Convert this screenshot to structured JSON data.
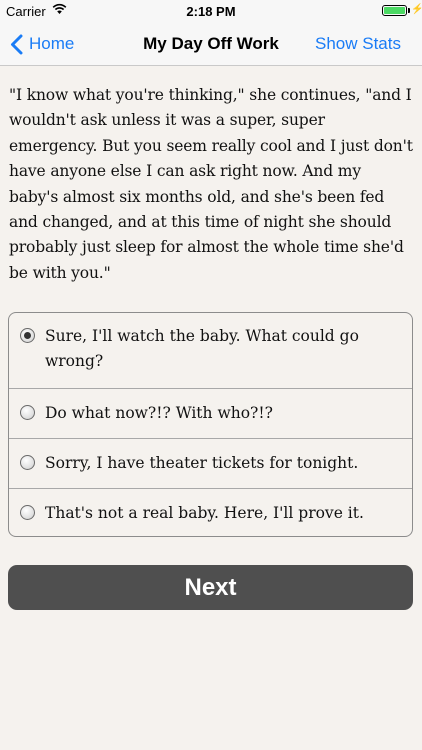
{
  "status_bar": {
    "carrier": "Carrier",
    "time": "2:18 PM",
    "wifi_icon": "wifi-icon",
    "battery_icon": "battery-icon",
    "battery_level": 1.0
  },
  "nav": {
    "back_label": "Home",
    "title": "My Day Off Work",
    "right_label": "Show Stats"
  },
  "story": {
    "text": "\"I know what you're thinking,\" she continues, \"and I wouldn't ask unless it was a super, super emergency. But you seem really cool and I just don't have anyone else I can ask right now. And my baby's almost six months old, and she's been fed and changed, and at this time of night she should probably just sleep for almost the whole time she'd be with you.\""
  },
  "choices": [
    {
      "label": "Sure, I'll watch the baby. What could go wrong?",
      "selected": true
    },
    {
      "label": "Do what now?!? With who?!?",
      "selected": false
    },
    {
      "label": "Sorry, I have theater tickets for tonight.",
      "selected": false
    },
    {
      "label": "That's not a real baby. Here, I'll prove it.",
      "selected": false
    }
  ],
  "next_label": "Next",
  "colors": {
    "background": "#f5f2ee",
    "accent": "#1a7cf6",
    "button": "#4f4f4f",
    "battery": "#4cd964"
  }
}
